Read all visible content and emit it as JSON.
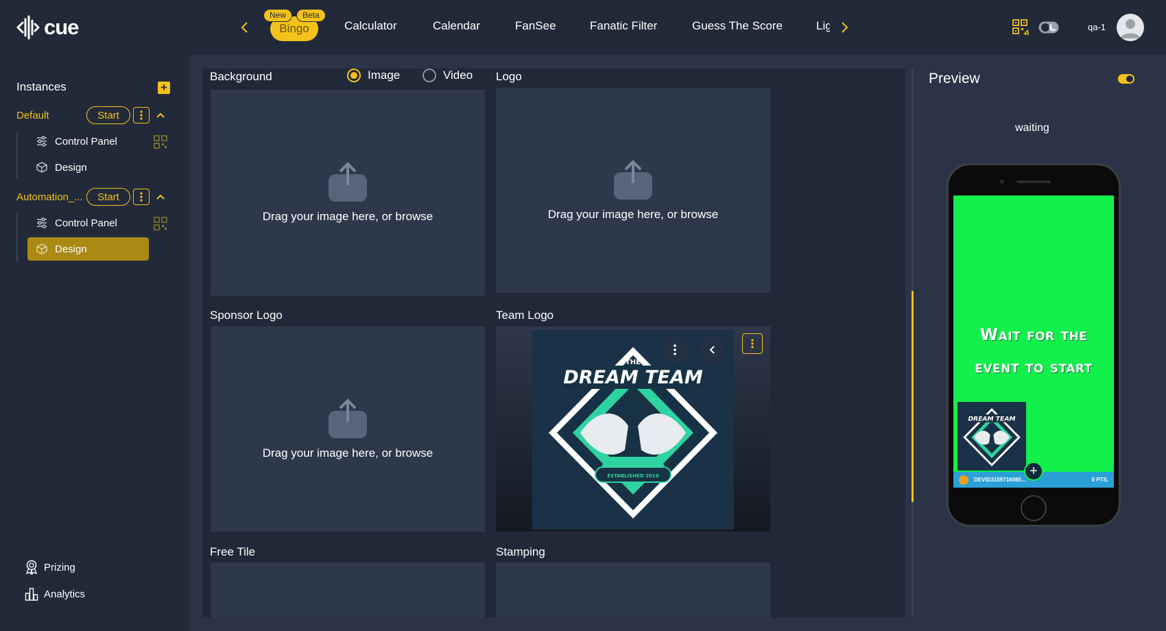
{
  "header": {
    "brand": "cue",
    "tabs": [
      {
        "label": "Bingo",
        "tags": [
          "New",
          "Beta"
        ],
        "active": true
      },
      {
        "label": "Calculator"
      },
      {
        "label": "Calendar"
      },
      {
        "label": "FanSee"
      },
      {
        "label": "Fanatic Filter"
      },
      {
        "label": "Guess The Score"
      },
      {
        "label": "Lig"
      }
    ],
    "user": "qa-1",
    "icons": [
      "chevron-left-icon",
      "chevron-right-icon",
      "qr-code-icon",
      "theme-toggle-icon",
      "user-avatar-icon"
    ]
  },
  "sidebar": {
    "title": "Instances",
    "add_icon": "plus-icon",
    "instances": [
      {
        "name": "Default",
        "start_label": "Start",
        "items": [
          {
            "label": "Control Panel",
            "icon": "sliders-icon"
          },
          {
            "label": "Design",
            "icon": "cube-icon"
          }
        ]
      },
      {
        "name": "Automation_...",
        "start_label": "Start",
        "items": [
          {
            "label": "Control Panel",
            "icon": "sliders-icon"
          },
          {
            "label": "Design",
            "icon": "cube-icon",
            "active": true
          }
        ]
      }
    ],
    "bottom": [
      {
        "label": "Prizing",
        "icon": "award-icon"
      },
      {
        "label": "Analytics",
        "icon": "bar-chart-icon"
      }
    ]
  },
  "main": {
    "background_label": "Background",
    "media_options": [
      {
        "label": "Image",
        "checked": true
      },
      {
        "label": "Video",
        "checked": false
      }
    ],
    "logo_label": "Logo",
    "sponsor_label": "Sponsor Logo",
    "team_logo_label": "Team Logo",
    "free_tile_label": "Free Tile",
    "stamping_label": "Stamping",
    "dropzone_text": "Drag your image here, or browse",
    "team_logo_image": {
      "line1": "THE",
      "line2": "DREAM TEAM",
      "line3": "ESTABLISHED 2010"
    }
  },
  "preview": {
    "title": "Preview",
    "status": "waiting",
    "screen_line1": "Wait for the",
    "screen_line2": "event to start",
    "player_id": "DEVID3159716080...",
    "points": "0 PTS."
  },
  "colors": {
    "accent": "#f4c21b",
    "background": "#222a39",
    "panel": "#2b3446",
    "preview_screen": "#12f04b"
  }
}
